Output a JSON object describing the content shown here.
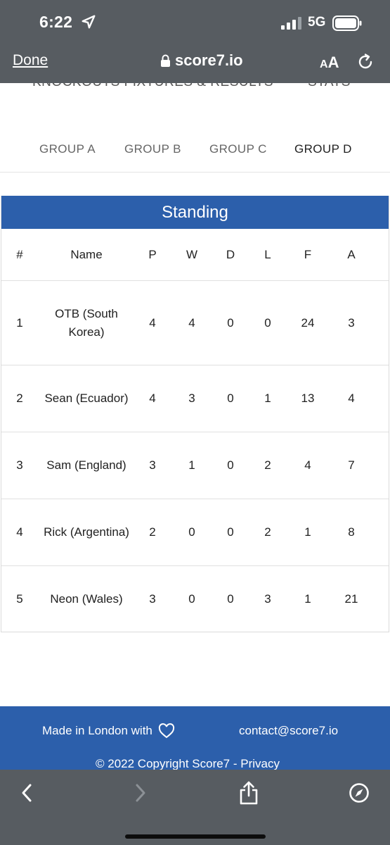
{
  "status": {
    "time": "6:22",
    "network": "5G"
  },
  "browser": {
    "done": "Done",
    "site": "score7.io",
    "aa_big": "A",
    "aa_small": "A"
  },
  "nav": {
    "items": [
      "KNOCKOUTS FIXTURES & RESULTS",
      "STATS"
    ]
  },
  "groups": {
    "tabs": [
      "GROUP A",
      "GROUP B",
      "GROUP C",
      "GROUP D"
    ],
    "active": "GROUP D"
  },
  "standing": {
    "title": "Standing",
    "columns": [
      "#",
      "Name",
      "P",
      "W",
      "D",
      "L",
      "F",
      "A"
    ],
    "rows": [
      {
        "rank": "1",
        "name": "OTB (South Korea)",
        "p": "4",
        "w": "4",
        "d": "0",
        "l": "0",
        "f": "24",
        "a": "3"
      },
      {
        "rank": "2",
        "name": "Sean (Ecuador)",
        "p": "4",
        "w": "3",
        "d": "0",
        "l": "1",
        "f": "13",
        "a": "4"
      },
      {
        "rank": "3",
        "name": "Sam (England)",
        "p": "3",
        "w": "1",
        "d": "0",
        "l": "2",
        "f": "4",
        "a": "7"
      },
      {
        "rank": "4",
        "name": "Rick (Argentina)",
        "p": "2",
        "w": "0",
        "d": "0",
        "l": "2",
        "f": "1",
        "a": "8"
      },
      {
        "rank": "5",
        "name": "Neon (Wales)",
        "p": "3",
        "w": "0",
        "d": "0",
        "l": "3",
        "f": "1",
        "a": "21"
      }
    ]
  },
  "footer": {
    "made": "Made in London with",
    "contact": "contact@score7.io",
    "copyright": "© 2022 Copyright Score7 - Privacy"
  },
  "colors": {
    "brand": "#2c5fab",
    "chrome": "#575c61"
  },
  "icons": [
    "location-arrow-icon",
    "signal-icon",
    "battery-icon",
    "lock-icon",
    "reload-icon",
    "heart-icon",
    "back-icon",
    "forward-icon",
    "share-icon",
    "compass-icon"
  ]
}
